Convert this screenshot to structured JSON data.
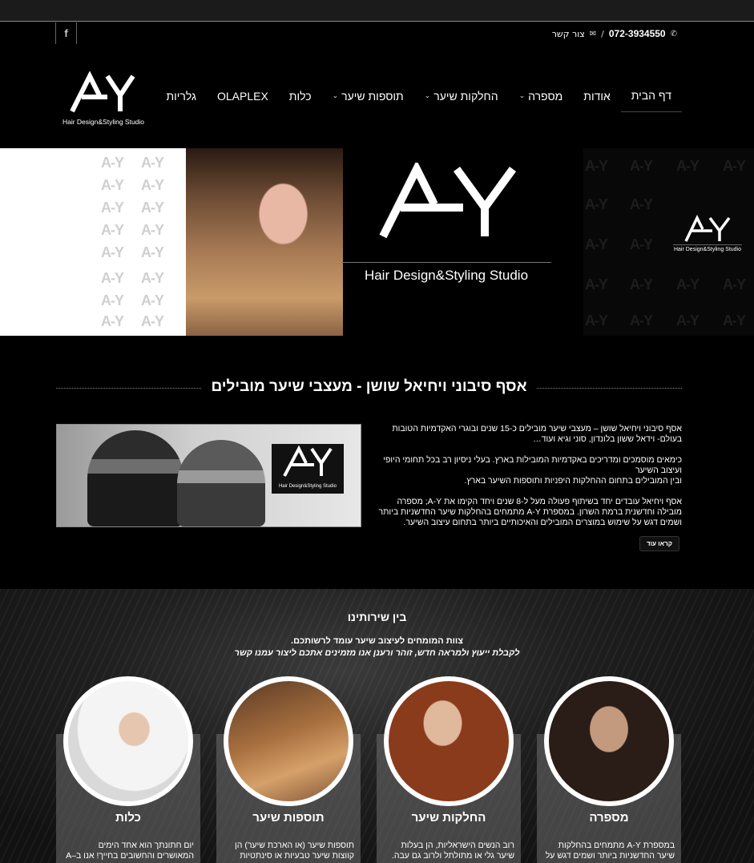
{
  "topbar": {
    "facebook_glyph": "f",
    "phone": "072-3934550",
    "separator": "/",
    "contact_label": "צור קשר"
  },
  "nav": {
    "items": [
      {
        "label": "דף הבית"
      },
      {
        "label": "אודות"
      },
      {
        "label": "מספרה"
      },
      {
        "label": "החלקות שיער"
      },
      {
        "label": "תוספות שיער"
      },
      {
        "label": "כלות"
      },
      {
        "label": "OLAPLEX"
      },
      {
        "label": "גלריות"
      }
    ]
  },
  "logo": {
    "mark": "A-Y",
    "tagline": "Hair Design&Styling Studio"
  },
  "banner": {
    "tagline": "Hair Design&Styling Studio",
    "small_tagline": "Hair Design&Styling Studio"
  },
  "about": {
    "title": "אסף סיבוני ויחיאל שושן - מעצבי שיער מובילים",
    "paragraphs": [
      "אסף סיבוני ויחיאל שושן – מעצבי שיער מובילים כ-15 שנים ובוגרי האקדמיות הטובות בעולם- וידאל ששון בלונדון, סוני וגיא ועוד…",
      "כימאים מוסמכים ומדריכים באקדמיות המובילות בארץ. בעלי ניסיון רב בכל תחומי היופי ועיצוב השיער\nובין המובילים בתחום ההחלקות היפניות ותוספות השיער בארץ.",
      "אסף ויחיאל עובדים יחד בשיתוף פעולה מעל ל-8 שנים ויחד הקימו את A-Y; מספרה מובילה וחדשנית ברמת השרון. במספרת A-Y מתמחים בהחלקות שיער החדשניות ביותר ושמים דגש על שימוש במוצרים המובילים והאיכותיים ביותר בתחום עיצוב השיער."
    ],
    "read_more": "קראו עוד",
    "image_logo_tag": "Hair Design&Styling Studio"
  },
  "services": {
    "title": "בין שירותינו",
    "subtitle_line1": "צוות המומחים לעיצוב שיער עומד לרשותכם.",
    "subtitle_line2": "לקבלת ייעוץ ולמראה חדש, זוהר ורענן אנו מזמינים אתכם ליצור עמנו קשר",
    "cards": [
      {
        "title": "מספרה",
        "text": "במספרת A-Y מתמחים בהחלקות שיער החדשניות ביותר ושמים דגש על"
      },
      {
        "title": "החלקות שיער",
        "text": "רוב הנשים הישראליות, הן בעלות שיער גלי או מתולתל ולרוב גם עבה."
      },
      {
        "title": "תוספות שיער",
        "text": "תוספות שיער (או הארכת שיער) הן קווצות שיער טבעיות או סינתטיות"
      },
      {
        "title": "כלות",
        "text": "יום חתונתך הוא אחד הימים המאושרים והחשובים בחייך! אנו ב–A"
      }
    ]
  },
  "colors": {
    "background": "#000000",
    "accent": "#ffffff",
    "card_bg": "#6e6e6e"
  }
}
